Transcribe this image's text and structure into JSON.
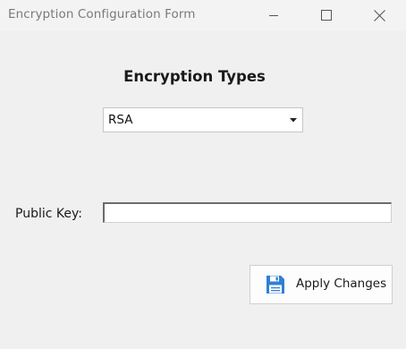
{
  "window": {
    "title": "Encryption Configuration Form",
    "controls": {
      "minimize_icon": "minimize-icon",
      "maximize_icon": "maximize-icon",
      "close_icon": "close-icon"
    }
  },
  "form": {
    "heading": "Encryption Types",
    "encryption_type": {
      "selected": "RSA",
      "arrow_icon": "dropdown-arrow-icon"
    },
    "public_key": {
      "label": "Public Key:",
      "value": "",
      "placeholder": ""
    },
    "apply_button": {
      "label": "Apply Changes",
      "icon": "save-floppy-icon"
    }
  },
  "colors": {
    "window_background": "#f0f0f0",
    "title_text": "#7a7a7a",
    "save_icon_blue": "#2f7fd6"
  }
}
